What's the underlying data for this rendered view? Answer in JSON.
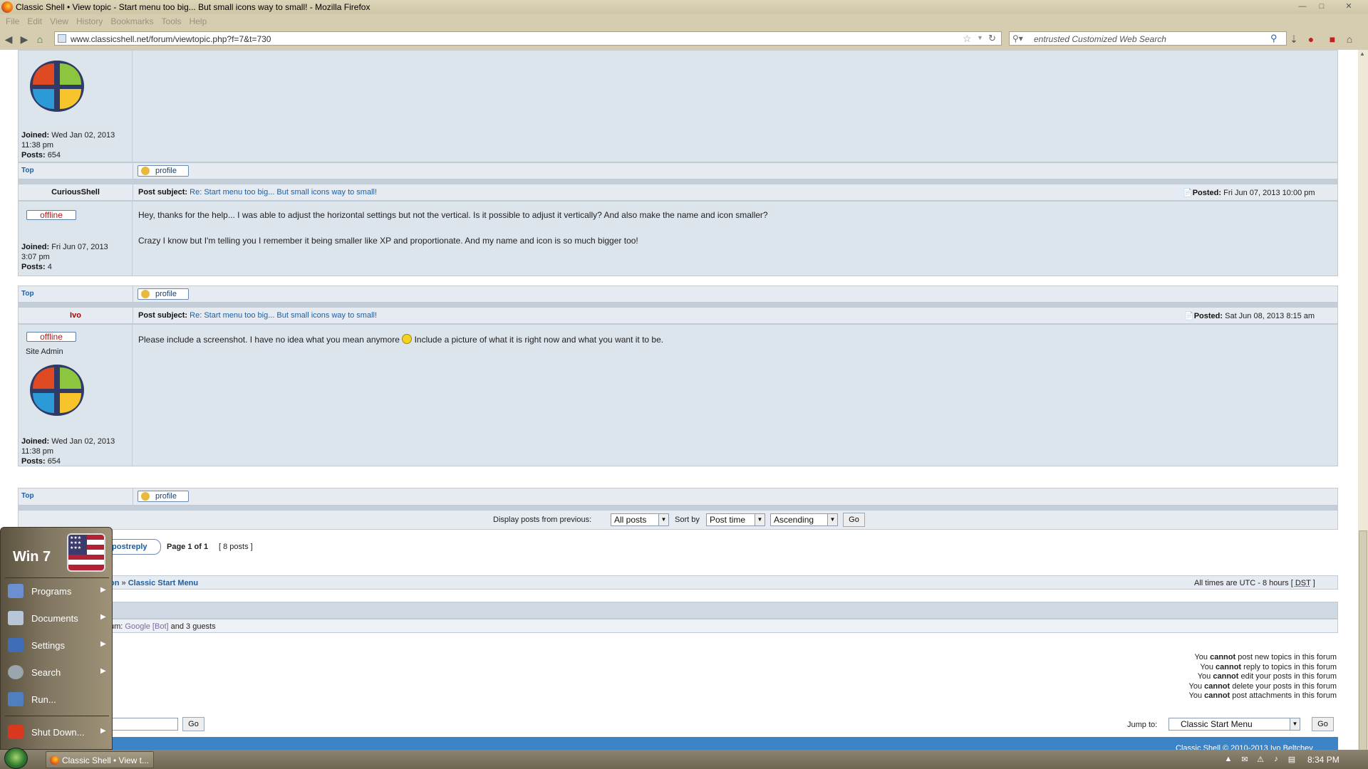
{
  "window": {
    "title": "Classic Shell • View topic - Start menu too big... But small icons way to small! - Mozilla Firefox",
    "menu": [
      "File",
      "Edit",
      "View",
      "History",
      "Bookmarks",
      "Tools",
      "Help"
    ],
    "url": "www.classicshell.net/forum/viewtopic.php?f=7&t=730",
    "search_placeholder": "entrusted Customized Web Search"
  },
  "posts": {
    "p1": {
      "joined_label": "Joined:",
      "joined_value": "Wed Jan 02, 2013",
      "joined_time": "11:38 pm",
      "posts_label": "Posts:",
      "posts_value": "654",
      "top_label": "Top",
      "profile_label": "profile"
    },
    "p2": {
      "author": "CuriousShell",
      "status": "offline",
      "subject_label": "Post subject:",
      "subject": "Re: Start menu too big... But small icons way to small!",
      "posted_label": "Posted:",
      "posted": "Fri Jun 07, 2013 10:00 pm",
      "line1": "Hey, thanks for the help... I was able to adjust the horizontal settings but not the vertical. Is it possible to adjust it vertically? And also make the name and icon smaller?",
      "line2": "Crazy I know but I'm telling you I remember it being smaller like XP and proportionate. And my name and icon is so much bigger too!",
      "joined_label": "Joined:",
      "joined_value": "Fri Jun 07, 2013",
      "joined_time": "3:07 pm",
      "posts_label": "Posts:",
      "posts_value": "4",
      "top_label": "Top",
      "profile_label": "profile"
    },
    "p3": {
      "author": "Ivo",
      "status": "offline",
      "rank": "Site Admin",
      "subject_label": "Post subject:",
      "subject": "Re: Start menu too big... But small icons way to small!",
      "posted_label": "Posted:",
      "posted": "Sat Jun 08, 2013 8:15 am",
      "body_a": "Please include a screenshot. I have no idea what you mean anymore",
      "body_b": "Include a picture of what it is right now and what you want it to be.",
      "joined_label": "Joined:",
      "joined_value": "Wed Jan 02, 2013",
      "joined_time": "11:38 pm",
      "posts_label": "Posts:",
      "posts_value": "654",
      "top_label": "Top",
      "profile_label": "profile"
    }
  },
  "display": {
    "label": "Display posts from previous:",
    "posts_value": "All posts",
    "sort_label": "Sort by",
    "sort_value": "Post time",
    "order_value": "Ascending",
    "go": "Go"
  },
  "pagination": {
    "reply_fragment": "postreply",
    "page_info": "Page 1 of 1",
    "count": "[ 8 posts ]"
  },
  "breadcrumb": {
    "fragment": "on",
    "sep": "»",
    "forum": "Classic Start Menu",
    "timezone": "All times are UTC - 8 hours [",
    "dst": "DST",
    "close": "]"
  },
  "who_online": {
    "prefix": "um:",
    "bot": "Google [Bot]",
    "rest": "and 3 guests"
  },
  "permissions": [
    {
      "a": "You",
      "b": "cannot",
      "c": "post new topics in this forum"
    },
    {
      "a": "You",
      "b": "cannot",
      "c": "reply to topics in this forum"
    },
    {
      "a": "You",
      "b": "cannot",
      "c": "edit your posts in this forum"
    },
    {
      "a": "You",
      "b": "cannot",
      "c": "delete your posts in this forum"
    },
    {
      "a": "You",
      "b": "cannot",
      "c": "post attachments in this forum"
    }
  ],
  "jump": {
    "search_go": "Go",
    "label": "Jump to:",
    "value": "Classic Start Menu",
    "go": "Go"
  },
  "footer_fragment": "Classic Shell © 2010-2013 Ivo Beltchev",
  "startmenu": {
    "brand": "Win 7",
    "items": [
      "Programs",
      "Documents",
      "Settings",
      "Search",
      "Run...",
      "Shut Down..."
    ]
  },
  "taskbar": {
    "task_label": "Classic Shell • View t...",
    "clock": "8:34 PM"
  },
  "colors": {
    "post_bg": "#dce4ec",
    "link": "#1f5ea0",
    "admin_name": "#aa0000",
    "offline": "#b31a1a"
  }
}
